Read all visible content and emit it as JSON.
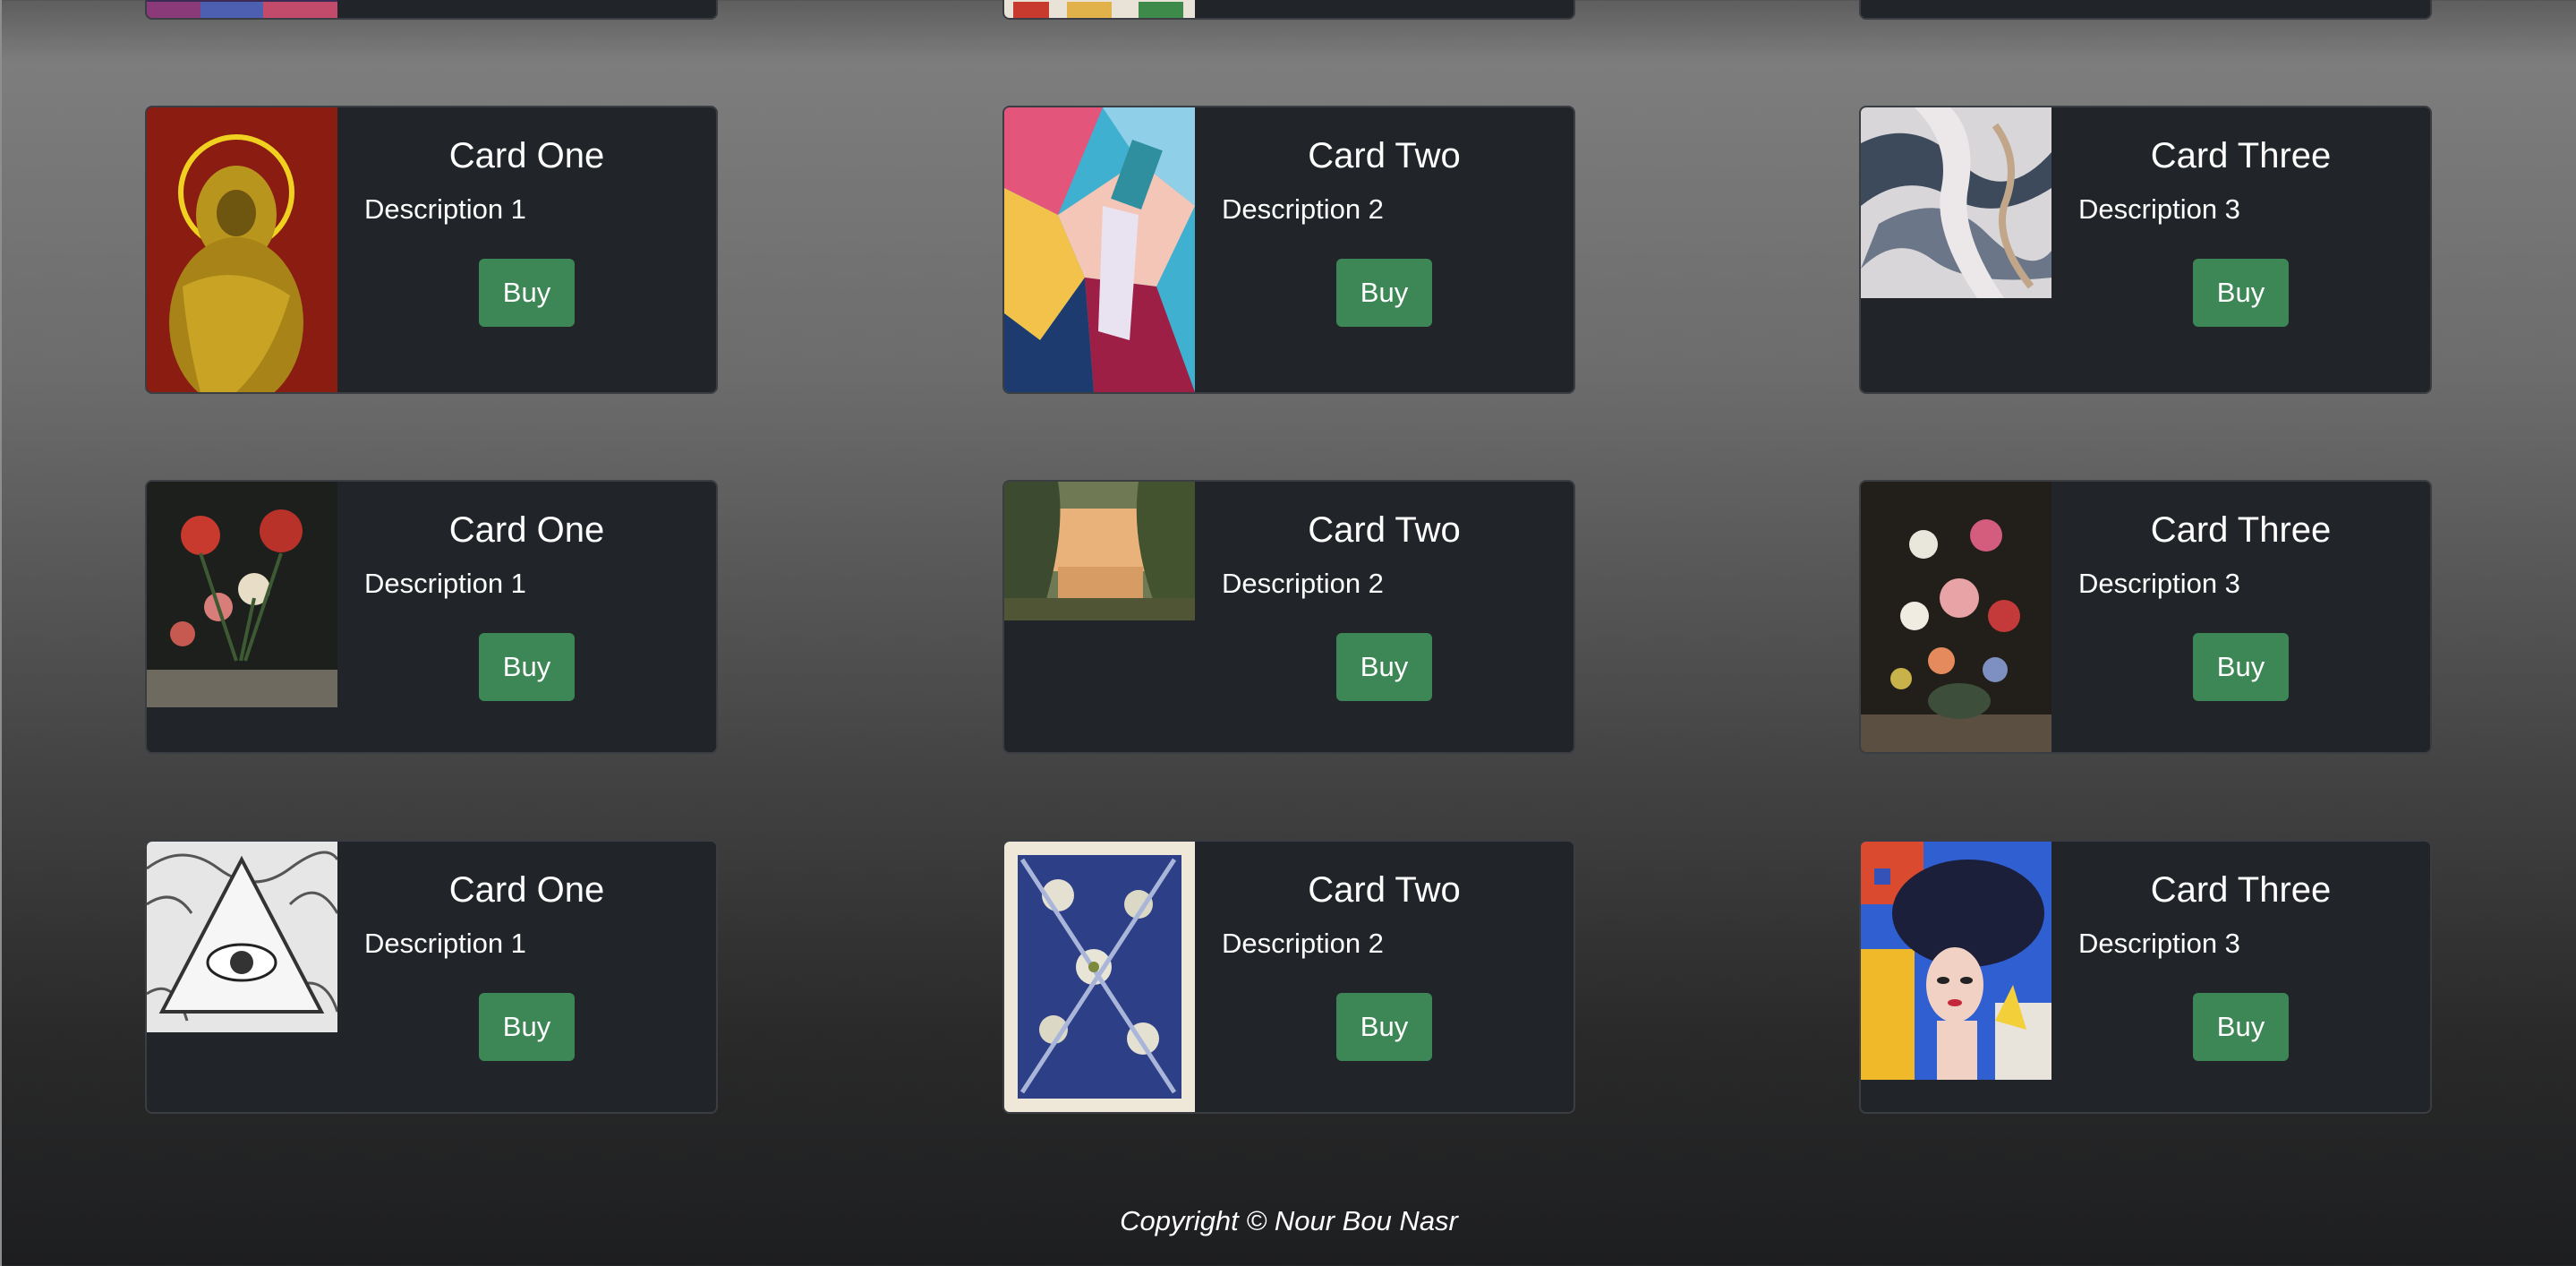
{
  "rows": [
    {
      "cards": [
        {
          "title": "",
          "description": "",
          "button": "",
          "image": "colorful-painting-strip"
        },
        {
          "title": "",
          "description": "",
          "button": "",
          "image": "floral-painting-strip"
        },
        {
          "title": "",
          "description": "",
          "button": "",
          "image": "painting-strip"
        }
      ]
    },
    {
      "cards": [
        {
          "title": "Card One",
          "description": "Description 1",
          "button": "Buy",
          "image": "golden-lion-halo-painting"
        },
        {
          "title": "Card Two",
          "description": "Description 2",
          "button": "Buy",
          "image": "abstract-hands-painting"
        },
        {
          "title": "Card Three",
          "description": "Description 3",
          "button": "Buy",
          "image": "marble-swirl-painting"
        }
      ]
    },
    {
      "cards": [
        {
          "title": "Card One",
          "description": "Description 1",
          "button": "Buy",
          "image": "red-flowers-still-life"
        },
        {
          "title": "Card Two",
          "description": "Description 2",
          "button": "Buy",
          "image": "jungle-lake-landscape"
        },
        {
          "title": "Card Three",
          "description": "Description 3",
          "button": "Buy",
          "image": "flower-bouquet-still-life"
        }
      ]
    },
    {
      "cards": [
        {
          "title": "Card One",
          "description": "Description 1",
          "button": "Buy",
          "image": "eye-triangle-drawing"
        },
        {
          "title": "Card Two",
          "description": "Description 2",
          "button": "Buy",
          "image": "blue-floral-pattern"
        },
        {
          "title": "Card Three",
          "description": "Description 3",
          "button": "Buy",
          "image": "pop-art-woman-portrait"
        }
      ]
    }
  ],
  "footer": {
    "copyright": "Copyright © Nour Bou Nasr"
  },
  "colors": {
    "card_bg": "#212529",
    "button_bg": "#3d8756",
    "text": "#ffffff"
  }
}
